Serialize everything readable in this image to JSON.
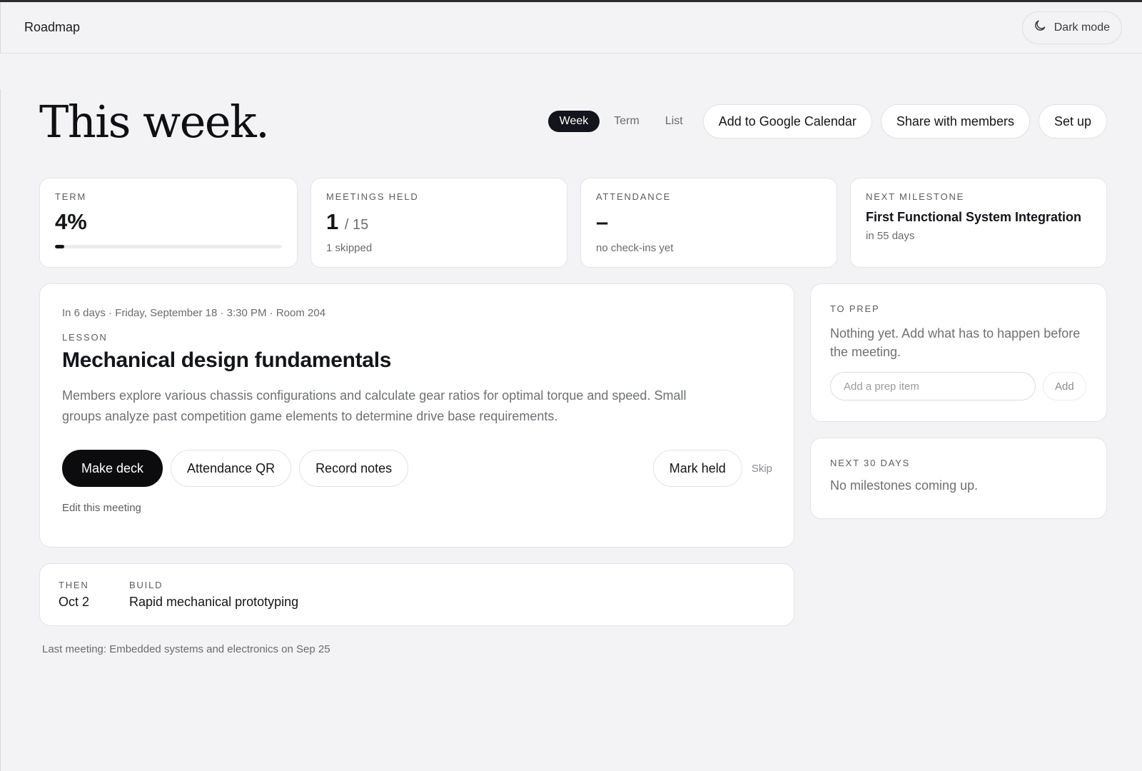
{
  "app": {
    "title": "Roadmap",
    "dark_mode_label": "Dark mode"
  },
  "header": {
    "title": "This week.",
    "views": [
      "Week",
      "Term",
      "List"
    ],
    "active_view": "Week",
    "actions": {
      "calendar": "Add to Google Calendar",
      "share": "Share with members",
      "setup": "Set up"
    }
  },
  "stats": {
    "term": {
      "label": "TERM",
      "value": "4%",
      "progress_fraction": 0.04
    },
    "meetings": {
      "label": "MEETINGS HELD",
      "held": "1",
      "total": "/ 15",
      "note": "1 skipped"
    },
    "attendance": {
      "label": "ATTENDANCE",
      "value": "–",
      "note": "no check-ins yet"
    },
    "milestone": {
      "label": "NEXT MILESTONE",
      "name": "First Functional System Integration",
      "note": "in 55 days"
    }
  },
  "meeting": {
    "meta": "In 6 days · Friday, September 18 · 3:30 PM · Room 204",
    "type": "LESSON",
    "title": "Mechanical design fundamentals",
    "description": "Members explore various chassis configurations and calculate gear ratios for optimal torque and speed. Small groups analyze past competition game elements to determine drive base requirements.",
    "buttons": {
      "deck": "Make deck",
      "qr": "Attendance QR",
      "notes": "Record notes",
      "held": "Mark held",
      "skip": "Skip"
    },
    "edit": "Edit this meeting"
  },
  "then": {
    "label": "THEN",
    "date": "Oct 2",
    "type": "BUILD",
    "title": "Rapid mechanical prototyping"
  },
  "last_meeting": "Last meeting: Embedded systems and electronics on Sep 25",
  "prep": {
    "label": "TO PREP",
    "empty": "Nothing yet. Add what has to happen before the meeting.",
    "placeholder": "Add a prep item",
    "add": "Add"
  },
  "next30": {
    "label": "NEXT 30 DAYS",
    "empty": "No milestones coming up."
  }
}
